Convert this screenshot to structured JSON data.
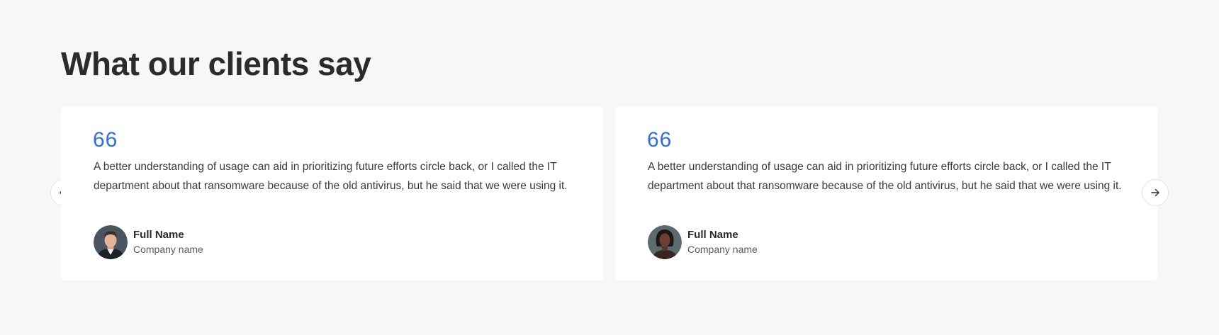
{
  "section": {
    "title": "What our clients say"
  },
  "testimonials": [
    {
      "quote_mark": "66",
      "text": "A better understanding of usage can aid in prioritizing future efforts circle back, or I called the IT department about that ransomware because of the old antivirus, but he said that we were using it.",
      "name": "Full Name",
      "company": "Company name",
      "avatar_icon": "avatar-man"
    },
    {
      "quote_mark": "66",
      "text": "A better understanding of usage can aid in prioritizing future efforts circle back, or I called the IT department about that ransomware because of the old antivirus, but he said that we were using it.",
      "name": "Full Name",
      "company": "Company name",
      "avatar_icon": "avatar-woman"
    }
  ],
  "navigation": {
    "prev_icon": "arrow-left-icon",
    "next_icon": "arrow-right-icon"
  },
  "colors": {
    "background": "#f7f7f7",
    "card": "#ffffff",
    "accent": "#2f6fe0",
    "heading": "#2b2b2b"
  }
}
